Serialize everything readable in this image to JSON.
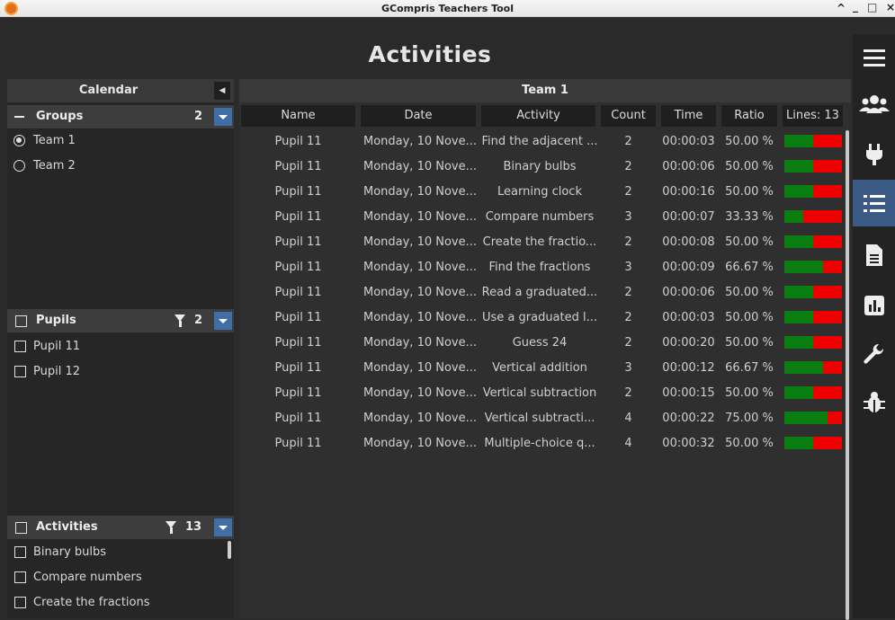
{
  "window": {
    "title": "GCompris Teachers Tool",
    "controls": [
      "^",
      "_",
      "□",
      "×"
    ]
  },
  "header": {
    "title": "Activities"
  },
  "calendar": {
    "label": "Calendar"
  },
  "groups": {
    "label": "Groups",
    "count": "2",
    "items": [
      "Team 1",
      "Team 2"
    ],
    "selected": 0
  },
  "pupils": {
    "label": "Pupils",
    "count": "2",
    "items": [
      "Pupil 11",
      "Pupil 12"
    ]
  },
  "activities_filter": {
    "label": "Activities",
    "count": "13",
    "items": [
      "Binary bulbs",
      "Compare numbers",
      "Create the fractions"
    ]
  },
  "table": {
    "team": "Team 1",
    "columns": [
      "Name",
      "Date",
      "Activity",
      "Count",
      "Time",
      "Ratio",
      "Lines: 13"
    ],
    "rows": [
      {
        "name": "Pupil 11",
        "date": "Monday, 10 Nove...",
        "activity": "Find the adjacent ...",
        "count": "2",
        "time": "00:00:03",
        "ratio": "50.00 %",
        "ratio_value": 0.5
      },
      {
        "name": "Pupil 11",
        "date": "Monday, 10 Nove...",
        "activity": "Binary bulbs",
        "count": "2",
        "time": "00:00:06",
        "ratio": "50.00 %",
        "ratio_value": 0.5
      },
      {
        "name": "Pupil 11",
        "date": "Monday, 10 Nove...",
        "activity": "Learning clock",
        "count": "2",
        "time": "00:00:16",
        "ratio": "50.00 %",
        "ratio_value": 0.5
      },
      {
        "name": "Pupil 11",
        "date": "Monday, 10 Nove...",
        "activity": "Compare numbers",
        "count": "3",
        "time": "00:00:07",
        "ratio": "33.33 %",
        "ratio_value": 0.3333
      },
      {
        "name": "Pupil 11",
        "date": "Monday, 10 Nove...",
        "activity": "Create the fractio...",
        "count": "2",
        "time": "00:00:08",
        "ratio": "50.00 %",
        "ratio_value": 0.5
      },
      {
        "name": "Pupil 11",
        "date": "Monday, 10 Nove...",
        "activity": "Find the fractions",
        "count": "3",
        "time": "00:00:09",
        "ratio": "66.67 %",
        "ratio_value": 0.6667
      },
      {
        "name": "Pupil 11",
        "date": "Monday, 10 Nove...",
        "activity": "Read a graduated...",
        "count": "2",
        "time": "00:00:06",
        "ratio": "50.00 %",
        "ratio_value": 0.5
      },
      {
        "name": "Pupil 11",
        "date": "Monday, 10 Nove...",
        "activity": "Use a graduated l...",
        "count": "2",
        "time": "00:00:03",
        "ratio": "50.00 %",
        "ratio_value": 0.5
      },
      {
        "name": "Pupil 11",
        "date": "Monday, 10 Nove...",
        "activity": "Guess 24",
        "count": "2",
        "time": "00:00:20",
        "ratio": "50.00 %",
        "ratio_value": 0.5
      },
      {
        "name": "Pupil 11",
        "date": "Monday, 10 Nove...",
        "activity": "Vertical addition",
        "count": "3",
        "time": "00:00:12",
        "ratio": "66.67 %",
        "ratio_value": 0.6667
      },
      {
        "name": "Pupil 11",
        "date": "Monday, 10 Nove...",
        "activity": "Vertical subtraction",
        "count": "2",
        "time": "00:00:15",
        "ratio": "50.00 %",
        "ratio_value": 0.5
      },
      {
        "name": "Pupil 11",
        "date": "Monday, 10 Nove...",
        "activity": "Vertical subtracti...",
        "count": "4",
        "time": "00:00:22",
        "ratio": "75.00 %",
        "ratio_value": 0.75
      },
      {
        "name": "Pupil 11",
        "date": "Monday, 10 Nove...",
        "activity": "Multiple-choice q...",
        "count": "4",
        "time": "00:00:32",
        "ratio": "50.00 %",
        "ratio_value": 0.5
      }
    ]
  },
  "sidebar": {
    "items": [
      {
        "icon": "menu-icon"
      },
      {
        "icon": "users-icon"
      },
      {
        "icon": "plug-icon"
      },
      {
        "icon": "list-icon",
        "active": true
      },
      {
        "icon": "document-icon"
      },
      {
        "icon": "chart-icon"
      },
      {
        "icon": "wrench-icon"
      },
      {
        "icon": "bug-icon"
      }
    ]
  },
  "colors": {
    "accent": "#3f6fa6",
    "ratio_good": "#0a7d10",
    "ratio_bad": "#ee0000",
    "background": "#2b2b2b"
  }
}
